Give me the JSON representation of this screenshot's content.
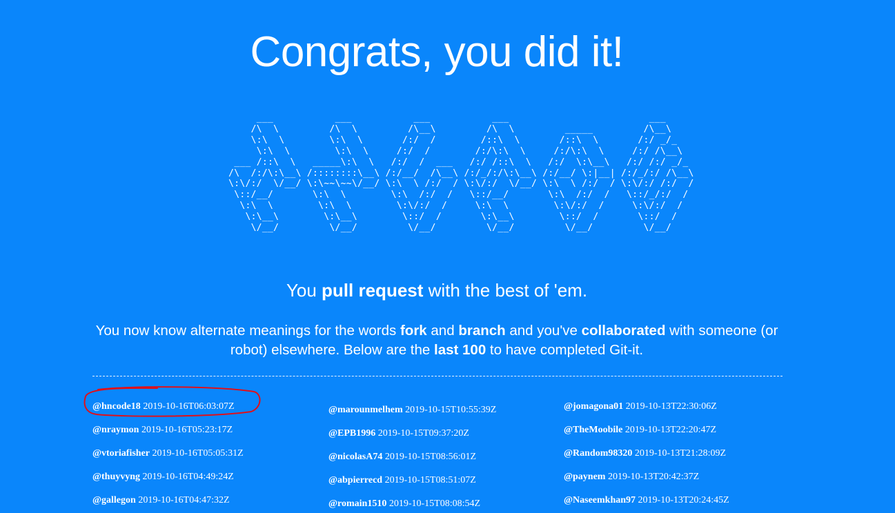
{
  "headline": "Congrats, you did it!",
  "ascii_art": "      ___           ___           ___           ___                         ___     \n     /\\  \\         /\\  \\         /\\__\\         /\\  \\         _____         /\\__\\    \n     \\:\\  \\        \\:\\  \\       /:/  /        /::\\  \\       /::\\  \\       /:/ _/_   \n      \\:\\  \\        \\:\\  \\     /:/  /        /:/\\:\\  \\     /:/\\:\\  \\     /:/ /\\__\\  \n  ___ /::\\  \\   _____\\:\\  \\   /:/  /  ___   /:/ /::\\  \\   /:/  \\:\\__\\   /:/ /:/ _/_ \n /\\  /:/\\:\\__\\ /::::::::\\__\\ /:/__/  /\\__\\ /:/_/:/\\:\\__\\ /:/__/ \\:|__| /:/_/:/ /\\__\\\n \\:\\/:/  \\/__/ \\:\\~~\\~~\\/__/ \\:\\  \\ /:/  / \\:\\/:/  \\/__/ \\:\\  \\ /:/  / \\:\\/:/ /:/  /\n  \\::/__/       \\:\\  \\        \\:\\  /:/  /   \\::/__/       \\:\\  /:/  /   \\::/_/:/  / \n   \\:\\  \\        \\:\\  \\        \\:\\/:/  /     \\:\\  \\        \\:\\/:/  /     \\:\\/:/  /  \n    \\:\\__\\        \\:\\__\\        \\::/  /       \\:\\__\\        \\::/  /       \\::/  /   \n     \\/__/         \\/__/         \\/__/         \\/__/         \\/__/         \\/__/    ",
  "tagline": {
    "before": "You ",
    "bold": "pull request",
    "after": " with the best of 'em."
  },
  "description": {
    "t1": "You now know alternate meanings for the words ",
    "b1": "fork",
    "t2": " and ",
    "b2": "branch",
    "t3": " and you've ",
    "b3": "collaborated",
    "t4": " with someone (or robot) elsewhere. Below are the ",
    "b4": "last 100",
    "t5": " to have completed Git-it."
  },
  "completions": {
    "col1": [
      {
        "user": "@hncode18",
        "time": "2019-10-16T06:03:07Z"
      },
      {
        "user": "@nraymon",
        "time": "2019-10-16T05:23:17Z"
      },
      {
        "user": "@vtoriafisher",
        "time": "2019-10-16T05:05:31Z"
      },
      {
        "user": "@thuyvyng",
        "time": "2019-10-16T04:49:24Z"
      },
      {
        "user": "@gallegon",
        "time": "2019-10-16T04:47:32Z"
      }
    ],
    "col2": [
      {
        "user": "@marounmelhem",
        "time": "2019-10-15T10:55:39Z"
      },
      {
        "user": "@EPB1996",
        "time": "2019-10-15T09:37:20Z"
      },
      {
        "user": "@nicolasA74",
        "time": "2019-10-15T08:56:01Z"
      },
      {
        "user": "@abpierrecd",
        "time": "2019-10-15T08:51:07Z"
      },
      {
        "user": "@romain1510",
        "time": "2019-10-15T08:08:54Z"
      }
    ],
    "col3": [
      {
        "user": "@jomagona01",
        "time": "2019-10-13T22:30:06Z"
      },
      {
        "user": "@TheMoobile",
        "time": "2019-10-13T22:20:47Z"
      },
      {
        "user": "@Random98320",
        "time": "2019-10-13T21:28:09Z"
      },
      {
        "user": "@paynem",
        "time": "2019-10-13T20:42:37Z"
      },
      {
        "user": "@Naseemkhan97",
        "time": "2019-10-13T20:24:45Z"
      }
    ]
  },
  "colors": {
    "background": "#0a86fb",
    "text": "#ffffff",
    "annotation": "#e0101a"
  }
}
